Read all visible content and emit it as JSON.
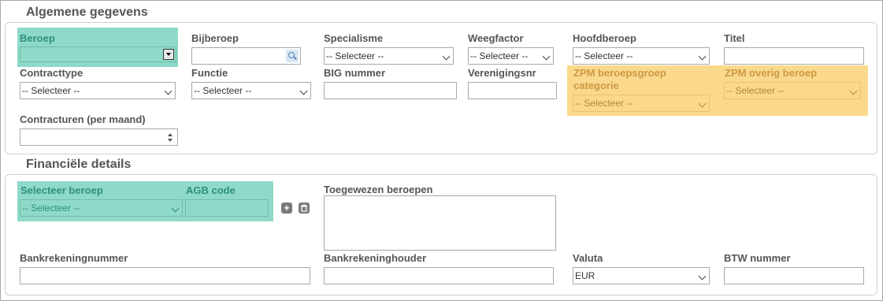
{
  "sections": {
    "general": "Algemene gegevens",
    "financial": "Financiële details"
  },
  "general": {
    "beroep": {
      "label": "Beroep",
      "value": ""
    },
    "bijberoep": {
      "label": "Bijberoep",
      "value": ""
    },
    "specialisme": {
      "label": "Specialisme",
      "value": "-- Selecteer --"
    },
    "weegfactor": {
      "label": "Weegfactor",
      "value": "-- Selecteer --"
    },
    "hoofdberoep": {
      "label": "Hoofdberoep",
      "value": "-- Selecteer --"
    },
    "titel": {
      "label": "Titel",
      "value": ""
    },
    "contracttype": {
      "label": "Contracttype",
      "value": "-- Selecteer --"
    },
    "functie": {
      "label": "Functie",
      "value": "-- Selecteer --"
    },
    "big": {
      "label": "BIG nummer",
      "value": ""
    },
    "verenigingsnr": {
      "label": "Verenigingsnr",
      "value": ""
    },
    "zpm_groep": {
      "label_line1": "ZPM beroepsgroep",
      "label_line2": "categorie",
      "value": "-- Selecteer --"
    },
    "zpm_overig": {
      "label": "ZPM overig beroep",
      "value": "-- Selecteer --"
    },
    "contracturen": {
      "label": "Contracturen (per maand)",
      "value": ""
    }
  },
  "financial": {
    "selecteer_beroep": {
      "label": "Selecteer beroep",
      "value": "-- Selecteer --"
    },
    "agb": {
      "label": "AGB code",
      "value": ""
    },
    "add_icon": "+",
    "toegewezen": {
      "label": "Toegewezen beroepen"
    },
    "bankrekeningnummer": {
      "label": "Bankrekeningnummer",
      "value": ""
    },
    "bankrekeninghouder": {
      "label": "Bankrekeninghouder",
      "value": ""
    },
    "valuta": {
      "label": "Valuta",
      "value": "EUR"
    },
    "btw": {
      "label": "BTW nummer",
      "value": ""
    }
  },
  "colors": {
    "highlight_green": "#8ed9c8",
    "highlight_yellow": "#fbd98c"
  }
}
